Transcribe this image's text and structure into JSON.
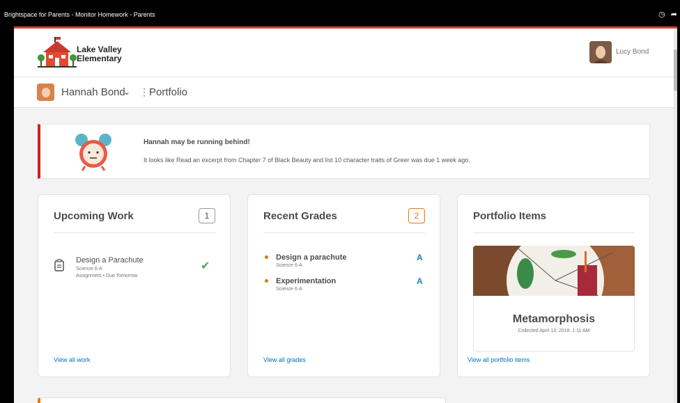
{
  "window": {
    "title": "Brightspace for Parents - Monitor Homework - Parents"
  },
  "header": {
    "school_line1": "Lake Valley",
    "school_line2": "Elementary",
    "user_name": "Lucy Bond"
  },
  "subheader": {
    "child_name": "Hannah Bond",
    "section": "Portfolio"
  },
  "alert": {
    "title": "Hannah may be running behind!",
    "message": "It looks like Read an excerpt from Chapter 7 of Black Beauty and list 10 character traits of Greer was due 1 week ago."
  },
  "upcoming_work": {
    "title": "Upcoming Work",
    "count": "1",
    "items": [
      {
        "title": "Design a Parachute",
        "course": "Science 6-A",
        "detail": "Assignment • Due Tomorrow"
      }
    ],
    "link": "View all work"
  },
  "recent_grades": {
    "title": "Recent Grades",
    "count": "2",
    "items": [
      {
        "title": "Design a parachute",
        "course": "Science 6-A",
        "grade": "A"
      },
      {
        "title": "Experimentation",
        "course": "Science 6-A",
        "grade": "A"
      }
    ],
    "link": "View all grades"
  },
  "portfolio_items": {
    "title": "Portfolio Items",
    "item_title": "Metamorphosis",
    "item_date": "Collected April 13, 2018, 1:11 AM",
    "link": "View all portfolio items"
  },
  "colors": {
    "accent_red": "#cd2026",
    "accent_orange": "#e87511",
    "link_blue": "#006fbf",
    "check_green": "#46a661"
  }
}
